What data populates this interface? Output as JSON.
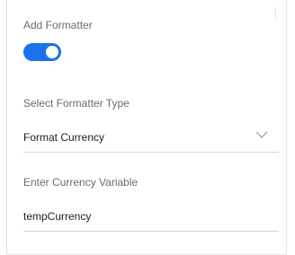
{
  "formatter": {
    "add_label": "Add Formatter",
    "toggle_on": true,
    "accent_color": "#1a73e8"
  },
  "type_select": {
    "label": "Select Formatter Type",
    "selected": "Format Currency",
    "icon": "chevron-down-icon"
  },
  "currency_field": {
    "label": "Enter Currency Variable",
    "value": "tempCurrency"
  }
}
